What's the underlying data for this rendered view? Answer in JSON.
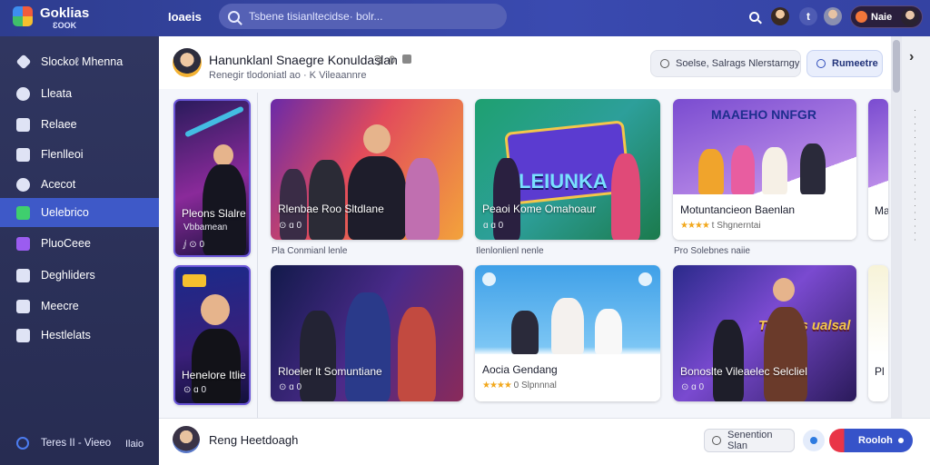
{
  "topbar": {
    "brand": "Goklias",
    "brand_sub": "ƐOOK",
    "nav_link": "Ioaeis",
    "search_placeholder": "Tsbene tisianltecidse· bolr..."
  },
  "header_actions": {
    "bell_glyph": "t",
    "profile_pill_label": "Naie"
  },
  "sidebar": {
    "items": [
      {
        "label": "Slockoℓ Mhenna",
        "icon": "diamond-icon"
      },
      {
        "label": "Lleata",
        "icon": "paint-icon"
      },
      {
        "label": "Relaee",
        "icon": "bookmark-icon"
      },
      {
        "label": "Flenlleoi",
        "icon": "mail-icon"
      },
      {
        "label": "Acecot",
        "icon": "user-icon"
      },
      {
        "label": "Uelebrico",
        "icon": "check-icon",
        "active": true
      },
      {
        "label": "PluoCeee",
        "icon": "cube-icon"
      },
      {
        "label": "Deghliders",
        "icon": "chat-icon"
      },
      {
        "label": "Meecre",
        "icon": "grid-icon"
      },
      {
        "label": "Hestlelats",
        "icon": "list-icon"
      }
    ],
    "footer_label": "Teres II - Vieeo",
    "footer_end": "Ilaio"
  },
  "main": {
    "title": "Hanunklanl Snaegre Konuldaslan",
    "title_meta": "Ϡ ·0",
    "subtitle": "Renegir tlodoniatl ao ·  K Vileaannre",
    "filter_placeholder": "Soelse, Salrags Nlerstarngy",
    "search_button": "Rumeetre"
  },
  "cards": {
    "row1": [
      {
        "title": "Pleons Slalre",
        "sub": "Vbbamean",
        "meta": "ⅉ ⊙ 0"
      },
      {
        "title": "Rlenbae Roo Sltdlane",
        "meta": "⊙ ɑ 0",
        "caption": "Pla Conmianl lenle"
      },
      {
        "title": "Peaoi Kome Omahoaur",
        "meta": "ɑ ɑ 0",
        "caption": "Ilenlonlienl nenle",
        "banner": "LEIUNKA"
      },
      {
        "title": "Motuntancieon Baenlan",
        "rating": "★★★★",
        "rating_text": "t Shgnerntai",
        "caption": "Pro Solebnes naiie",
        "banner": "MAAEHO NNFGR"
      }
    ],
    "row2": [
      {
        "title": "Henelore Itlie",
        "meta": "⊙ ɑ 0"
      },
      {
        "title": "Rloeler lt Somuntiane",
        "meta": "⊙ ɑ 0"
      },
      {
        "title": "Aocia Gendang",
        "rating": "★★★★",
        "rating_text": "0 Slpnnnal"
      },
      {
        "title": "Bonoslte Vileaelec Selcliel",
        "meta": "⊙ ɑ 0",
        "banner": "Tunrios ualsal"
      }
    ],
    "peek": {
      "row1": "Ma",
      "row2": "Pl"
    }
  },
  "bottombar": {
    "name": "Reng Heetdoagh",
    "secondary_button": "Senention Slan",
    "primary_button": "Rooloh"
  },
  "colors": {
    "topbar": "#3a4ab0",
    "sidebar": "#303660",
    "active_item": "#3e59c8",
    "accent_red": "#e93547",
    "star": "#f2a81d"
  }
}
